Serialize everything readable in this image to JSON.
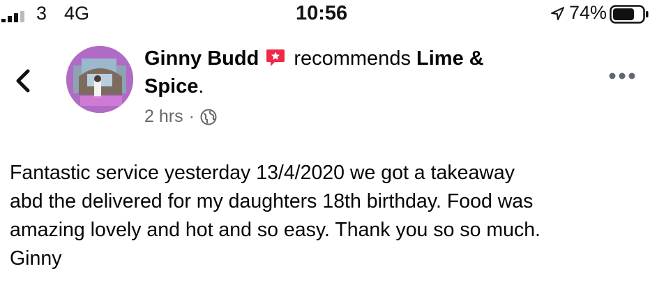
{
  "status_bar": {
    "carrier": "3",
    "network": "4G",
    "time": "10:56",
    "battery_percent": "74%",
    "signal_bars_filled": 3,
    "signal_bars_total": 4,
    "battery_level": 0.74,
    "icons": [
      "signal-icon",
      "location-arrow-icon",
      "battery-icon"
    ]
  },
  "post": {
    "author": "Ginny Budd",
    "recommend_text": "recommends",
    "page_name": "Lime &",
    "page_name_cont": "Spice",
    "page_name_suffix": ".",
    "timestamp": "2 hrs",
    "separator": "·",
    "audience_icon": "globe-icon",
    "body": "Fantastic service yesterday 13/4/2020 we got a takeaway\nabd the delivered for my daughters 18th birthday. Food was\namazing lovely and hot and so easy. Thank you so so much.\nGinny"
  },
  "colors": {
    "text_primary": "#050505",
    "text_secondary": "#65676b",
    "badge_red": "#f0284a",
    "background": "#ffffff"
  }
}
